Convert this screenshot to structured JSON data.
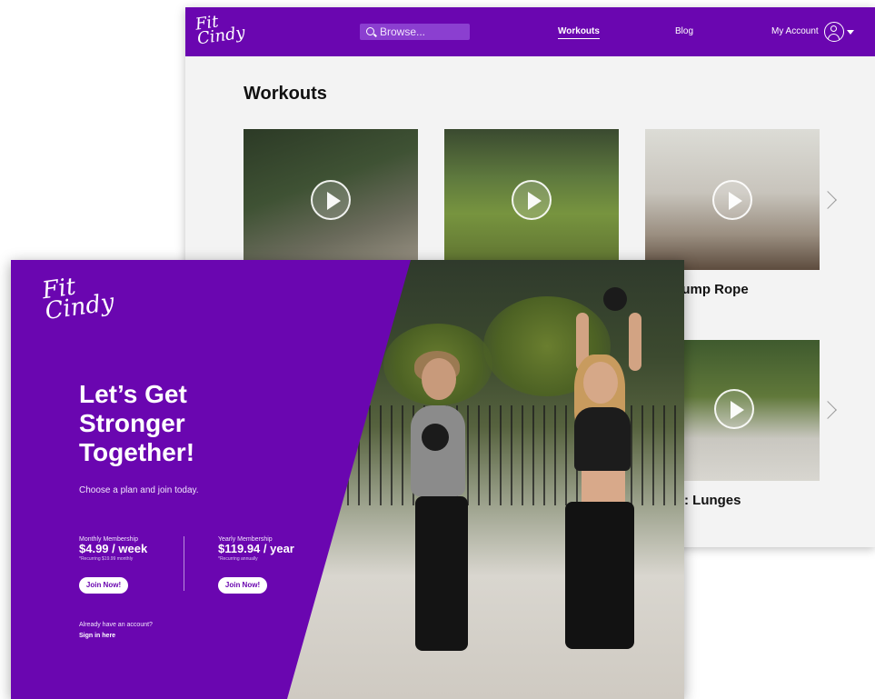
{
  "back_window": {
    "logo": {
      "line1": "Fit",
      "line2": "Cindy"
    },
    "search": {
      "placeholder": "Browse..."
    },
    "nav": {
      "workouts": "Workouts",
      "blog": "Blog",
      "account": "My Account"
    },
    "section_title": "Workouts",
    "cards": [
      {
        "title": ""
      },
      {
        "title": ""
      },
      {
        "title": "o III: Jump Rope"
      },
      {
        "title": "gth III: Lunges"
      }
    ]
  },
  "front_window": {
    "logo": {
      "line1": "Fit",
      "line2": "Cindy"
    },
    "headline": "Let’s Get Stronger Together!",
    "subline": "Choose a plan and join today.",
    "plans": [
      {
        "label": "Monthly Membership",
        "price": "$4.99 / week",
        "note": "*Recurring $19.99 monthly",
        "cta": "Join Now!"
      },
      {
        "label": "Yearly Membership",
        "price": "$119.94 / year",
        "note": "*Recurring annually",
        "cta": "Join Now!"
      }
    ],
    "account_prompt": "Already have an account?",
    "signin": "Sign in here"
  },
  "colors": {
    "brand_purple": "#6a06b0",
    "background": "#f3f3f3",
    "text": "#111111"
  },
  "icons": [
    "search-icon",
    "account-icon",
    "chevron-down-icon",
    "play-icon",
    "chevron-right-icon"
  ]
}
